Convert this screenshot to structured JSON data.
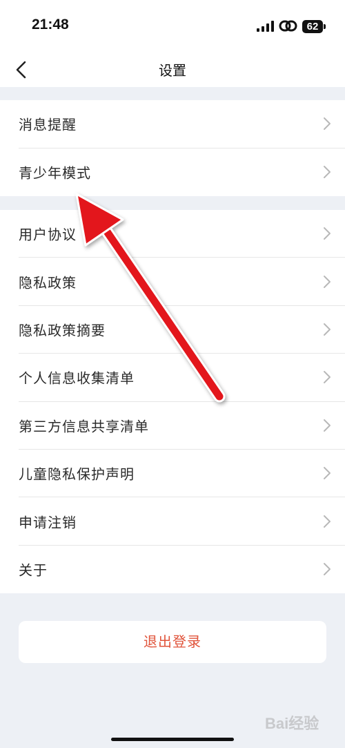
{
  "status_bar": {
    "time": "21:48",
    "battery": "62",
    "icons": [
      "signal-icon",
      "link-icon",
      "battery-icon"
    ]
  },
  "nav": {
    "title": "设置",
    "back_icon": "chevron-left-icon"
  },
  "groups": [
    {
      "items": [
        {
          "label": "消息提醒"
        },
        {
          "label": "青少年模式"
        }
      ]
    },
    {
      "items": [
        {
          "label": "用户协议"
        },
        {
          "label": "隐私政策"
        },
        {
          "label": "隐私政策摘要"
        },
        {
          "label": "个人信息收集清单"
        },
        {
          "label": "第三方信息共享清单"
        },
        {
          "label": "儿童隐私保护声明"
        },
        {
          "label": "申请注销"
        },
        {
          "label": "关于"
        }
      ]
    }
  ],
  "logout": {
    "label": "退出登录"
  },
  "annotation": {
    "color": "#e3141b",
    "points_to": "青少年模式"
  },
  "watermark": {
    "text": "Bai经验"
  },
  "colors": {
    "page_bg": "#edf0f5",
    "logout_text": "#e0533a"
  }
}
